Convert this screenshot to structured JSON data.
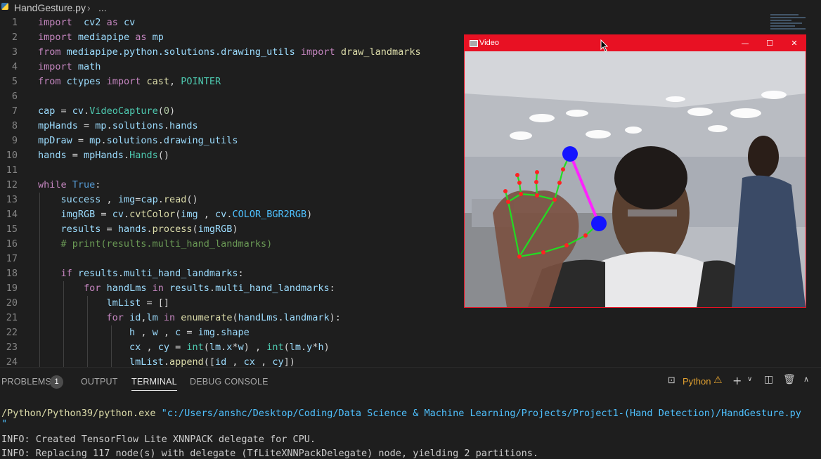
{
  "breadcrumb": {
    "file": "HandGesture.py",
    "separator": "›",
    "more": "..."
  },
  "code": [
    {
      "n": "1",
      "tokens": [
        [
          "kw",
          "import"
        ],
        [
          "",
          "  "
        ],
        [
          "var",
          "cv2"
        ],
        [
          "",
          " "
        ],
        [
          "kw",
          "as"
        ],
        [
          "",
          " "
        ],
        [
          "var",
          "cv"
        ]
      ]
    },
    {
      "n": "2",
      "tokens": [
        [
          "kw",
          "import"
        ],
        [
          "",
          " "
        ],
        [
          "var",
          "mediapipe"
        ],
        [
          "",
          " "
        ],
        [
          "kw",
          "as"
        ],
        [
          "",
          " "
        ],
        [
          "var",
          "mp"
        ]
      ]
    },
    {
      "n": "3",
      "tokens": [
        [
          "kw",
          "from"
        ],
        [
          "",
          " "
        ],
        [
          "var",
          "mediapipe.python.solutions.drawing_utils"
        ],
        [
          "",
          " "
        ],
        [
          "kw",
          "import"
        ],
        [
          "",
          " "
        ],
        [
          "fn",
          "draw_landmarks"
        ]
      ]
    },
    {
      "n": "4",
      "tokens": [
        [
          "kw",
          "import"
        ],
        [
          "",
          " "
        ],
        [
          "var",
          "math"
        ]
      ]
    },
    {
      "n": "5",
      "tokens": [
        [
          "kw",
          "from"
        ],
        [
          "",
          " "
        ],
        [
          "var",
          "ctypes"
        ],
        [
          "",
          " "
        ],
        [
          "kw",
          "import"
        ],
        [
          "",
          " "
        ],
        [
          "fn",
          "cast"
        ],
        [
          "",
          ", "
        ],
        [
          "cls",
          "POINTER"
        ]
      ]
    },
    {
      "n": "6",
      "tokens": []
    },
    {
      "n": "7",
      "tokens": [
        [
          "var",
          "cap"
        ],
        [
          "",
          " = "
        ],
        [
          "var",
          "cv"
        ],
        [
          "",
          "."
        ],
        [
          "cls",
          "VideoCapture"
        ],
        [
          "",
          "("
        ],
        [
          "num",
          "0"
        ],
        [
          "",
          ")"
        ]
      ]
    },
    {
      "n": "8",
      "tokens": [
        [
          "var",
          "mpHands"
        ],
        [
          "",
          " = "
        ],
        [
          "var",
          "mp"
        ],
        [
          "",
          "."
        ],
        [
          "var",
          "solutions"
        ],
        [
          "",
          "."
        ],
        [
          "var",
          "hands"
        ]
      ]
    },
    {
      "n": "9",
      "tokens": [
        [
          "var",
          "mpDraw"
        ],
        [
          "",
          " = "
        ],
        [
          "var",
          "mp"
        ],
        [
          "",
          "."
        ],
        [
          "var",
          "solutions"
        ],
        [
          "",
          "."
        ],
        [
          "var",
          "drawing_utils"
        ]
      ]
    },
    {
      "n": "10",
      "tokens": [
        [
          "var",
          "hands"
        ],
        [
          "",
          " = "
        ],
        [
          "var",
          "mpHands"
        ],
        [
          "",
          "."
        ],
        [
          "cls",
          "Hands"
        ],
        [
          "",
          "()"
        ]
      ]
    },
    {
      "n": "11",
      "tokens": []
    },
    {
      "n": "12",
      "tokens": [
        [
          "kw",
          "while"
        ],
        [
          "",
          " "
        ],
        [
          "kw2",
          "True"
        ],
        [
          "",
          ":"
        ]
      ]
    },
    {
      "n": "13",
      "tokens": [
        [
          "",
          "    "
        ],
        [
          "var",
          "success"
        ],
        [
          "",
          " , "
        ],
        [
          "var",
          "img"
        ],
        [
          "",
          "="
        ],
        [
          "var",
          "cap"
        ],
        [
          "",
          "."
        ],
        [
          "fn",
          "read"
        ],
        [
          "",
          "()"
        ]
      ]
    },
    {
      "n": "14",
      "tokens": [
        [
          "",
          "    "
        ],
        [
          "var",
          "imgRGB"
        ],
        [
          "",
          " = "
        ],
        [
          "var",
          "cv"
        ],
        [
          "",
          "."
        ],
        [
          "fn",
          "cvtColor"
        ],
        [
          "",
          "("
        ],
        [
          "var",
          "img"
        ],
        [
          "",
          " , "
        ],
        [
          "var",
          "cv"
        ],
        [
          "",
          "."
        ],
        [
          "const",
          "COLOR_BGR2RGB"
        ],
        [
          "",
          ")"
        ]
      ]
    },
    {
      "n": "15",
      "tokens": [
        [
          "",
          "    "
        ],
        [
          "var",
          "results"
        ],
        [
          "",
          " = "
        ],
        [
          "var",
          "hands"
        ],
        [
          "",
          "."
        ],
        [
          "fn",
          "process"
        ],
        [
          "",
          "("
        ],
        [
          "var",
          "imgRGB"
        ],
        [
          "",
          ")"
        ]
      ]
    },
    {
      "n": "16",
      "tokens": [
        [
          "",
          "    "
        ],
        [
          "cmt",
          "# print(results.multi_hand_landmarks)"
        ]
      ]
    },
    {
      "n": "17",
      "tokens": []
    },
    {
      "n": "18",
      "tokens": [
        [
          "",
          "    "
        ],
        [
          "kw",
          "if"
        ],
        [
          "",
          " "
        ],
        [
          "var",
          "results"
        ],
        [
          "",
          "."
        ],
        [
          "var",
          "multi_hand_landmarks"
        ],
        [
          "",
          ":"
        ]
      ]
    },
    {
      "n": "19",
      "tokens": [
        [
          "",
          "        "
        ],
        [
          "kw",
          "for"
        ],
        [
          "",
          " "
        ],
        [
          "var",
          "handLms"
        ],
        [
          "",
          " "
        ],
        [
          "kw",
          "in"
        ],
        [
          "",
          " "
        ],
        [
          "var",
          "results"
        ],
        [
          "",
          "."
        ],
        [
          "var",
          "multi_hand_landmarks"
        ],
        [
          "",
          ":"
        ]
      ]
    },
    {
      "n": "20",
      "tokens": [
        [
          "",
          "            "
        ],
        [
          "var",
          "lmList"
        ],
        [
          "",
          " = []"
        ]
      ]
    },
    {
      "n": "21",
      "tokens": [
        [
          "",
          "            "
        ],
        [
          "kw",
          "for"
        ],
        [
          "",
          " "
        ],
        [
          "var",
          "id"
        ],
        [
          "",
          ","
        ],
        [
          "var",
          "lm"
        ],
        [
          "",
          " "
        ],
        [
          "kw",
          "in"
        ],
        [
          "",
          " "
        ],
        [
          "fn",
          "enumerate"
        ],
        [
          "",
          "("
        ],
        [
          "var",
          "handLms"
        ],
        [
          "",
          "."
        ],
        [
          "var",
          "landmark"
        ],
        [
          "",
          "):"
        ]
      ]
    },
    {
      "n": "22",
      "tokens": [
        [
          "",
          "                "
        ],
        [
          "var",
          "h"
        ],
        [
          "",
          " , "
        ],
        [
          "var",
          "w"
        ],
        [
          "",
          " , "
        ],
        [
          "var",
          "c"
        ],
        [
          "",
          " = "
        ],
        [
          "var",
          "img"
        ],
        [
          "",
          "."
        ],
        [
          "var",
          "shape"
        ]
      ]
    },
    {
      "n": "23",
      "tokens": [
        [
          "",
          "                "
        ],
        [
          "var",
          "cx"
        ],
        [
          "",
          " , "
        ],
        [
          "var",
          "cy"
        ],
        [
          "",
          " = "
        ],
        [
          "cls",
          "int"
        ],
        [
          "",
          "("
        ],
        [
          "var",
          "lm"
        ],
        [
          "",
          "."
        ],
        [
          "var",
          "x"
        ],
        [
          "",
          "*"
        ],
        [
          "var",
          "w"
        ],
        [
          "",
          ") , "
        ],
        [
          "cls",
          "int"
        ],
        [
          "",
          "("
        ],
        [
          "var",
          "lm"
        ],
        [
          "",
          "."
        ],
        [
          "var",
          "y"
        ],
        [
          "",
          "*"
        ],
        [
          "var",
          "h"
        ],
        [
          "",
          ")"
        ]
      ]
    },
    {
      "n": "24",
      "tokens": [
        [
          "",
          "                "
        ],
        [
          "var",
          "lmList"
        ],
        [
          "",
          "."
        ],
        [
          "fn",
          "append"
        ],
        [
          "",
          "(["
        ],
        [
          "var",
          "id"
        ],
        [
          "",
          " , "
        ],
        [
          "var",
          "cx"
        ],
        [
          "",
          " , "
        ],
        [
          "var",
          "cy"
        ],
        [
          "",
          "])"
        ]
      ]
    }
  ],
  "video_window": {
    "title": "Video",
    "minimize": "—",
    "maximize": "☐",
    "close": "✕",
    "colors": {
      "titlebar": "#e81123",
      "bone": "#22dd22",
      "joint": "#ff2222",
      "tip": "#1414ff",
      "line": "#ff22ff"
    }
  },
  "panel": {
    "tabs": [
      {
        "label": "PROBLEMS",
        "active": false
      },
      {
        "label": "OUTPUT",
        "active": false
      },
      {
        "label": "TERMINAL",
        "active": true
      },
      {
        "label": "DEBUG CONSOLE",
        "active": false
      }
    ],
    "problems_count": "1",
    "terminal_name": "Python",
    "terminal_lines": [
      {
        "path": "/Python/Python39/python.exe",
        "arg": " \"c:/Users/anshc/Desktop/Coding/Data Science & Machine Learning/Projects/Project1-(Hand Detection)/HandGesture.py"
      },
      {
        "text": "\""
      },
      {
        "text": "INFO: Created TensorFlow Lite XNNPACK delegate for CPU."
      },
      {
        "text": "INFO: Replacing 117 node(s) with delegate (TfLiteXNNPackDelegate) node, yielding 2 partitions."
      }
    ]
  }
}
